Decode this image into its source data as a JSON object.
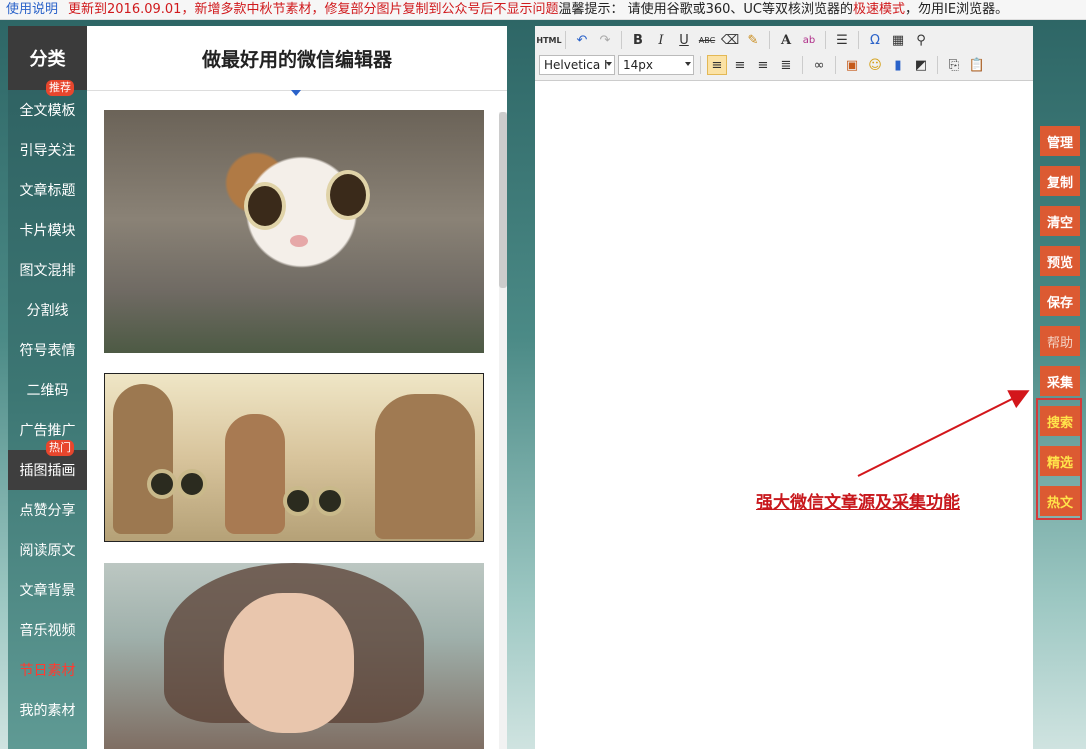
{
  "topbar": {
    "help_link": "使用说明",
    "update_text": "更新到2016.09.01，新增多款中秋节素材，修复部分图片复制到公众号后不显示问题",
    "tip_prefix": "温馨提示： 请使用谷歌或360、UC等双核浏览器的",
    "tip_highlight": "极速模式",
    "tip_suffix": "，勿用IE浏览器。"
  },
  "sidebar": {
    "header": "分类",
    "items": [
      {
        "label": "全文模板",
        "badge": "推荐"
      },
      {
        "label": "引导关注"
      },
      {
        "label": "文章标题"
      },
      {
        "label": "卡片模块"
      },
      {
        "label": "图文混排"
      },
      {
        "label": "分割线"
      },
      {
        "label": "符号表情"
      },
      {
        "label": "二维码"
      },
      {
        "label": "广告推广"
      },
      {
        "label": "插图插画",
        "badge": "热门"
      },
      {
        "label": "点赞分享"
      },
      {
        "label": "阅读原文"
      },
      {
        "label": "文章背景"
      },
      {
        "label": "音乐视频"
      },
      {
        "label": "节日素材"
      },
      {
        "label": "我的素材"
      }
    ],
    "active_index": 9,
    "red_index": 14
  },
  "panel": {
    "title": "做最好用的微信编辑器",
    "items": [
      "cat-photo",
      "animals-photo",
      "girl-photo"
    ]
  },
  "editor": {
    "toolbar_row1": [
      "html-icon",
      "undo-icon",
      "redo-icon",
      "bold-icon",
      "italic-icon",
      "underline-icon",
      "strikethrough-icon",
      "eraser-icon",
      "format-painter-icon",
      "font-color-icon",
      "highlight-icon",
      "line-height-icon",
      "omega-icon",
      "table-icon",
      "binoculars-icon"
    ],
    "html_label": "HTML",
    "bold_label": "B",
    "italic_label": "I",
    "underline_label": "U",
    "strike_label": "ABC",
    "font_color_label": "A",
    "highlight_label": "ab",
    "omega_label": "Ω",
    "font_family": "Helvetica I",
    "font_size": "14px",
    "toolbar_row2": [
      "align-left-icon",
      "align-center-icon",
      "align-right-icon",
      "align-justify-icon",
      "link-icon",
      "image-icon",
      "emoticon-icon",
      "video-icon",
      "map-icon",
      "code-icon",
      "paste-icon"
    ]
  },
  "actions": {
    "buttons": [
      "管理",
      "复制",
      "清空",
      "预览",
      "保存",
      "帮助",
      "采集",
      "搜索",
      "精选",
      "热文"
    ]
  },
  "annotation": {
    "caption": "强大微信文章源及采集功能"
  },
  "colors": {
    "accent": "#dc5a32",
    "highlight_red": "#d23b3b",
    "link_blue": "#2a62c9"
  }
}
